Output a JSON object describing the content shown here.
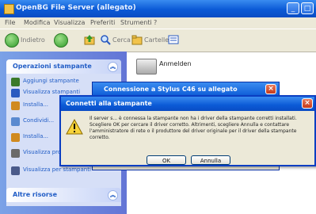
{
  "window": {
    "title": "OpenBG File Server (allegato)",
    "menu": [
      "File",
      "Modifica",
      "Visualizza",
      "Preferiti",
      "Strumenti",
      "?"
    ],
    "toolbar": {
      "back_label": "Indietro",
      "search_label": "Cerca",
      "folders_label": "Cartelle"
    }
  },
  "task_pane": {
    "section_title": "Operazioni stampante",
    "tasks": [
      {
        "label": "Aggiungi stampante",
        "icon": "add-printer-icon",
        "color": "#3a7a2a"
      },
      {
        "label": "Visualizza stampanti",
        "icon": "view-icon",
        "color": "#2a5ac0"
      },
      {
        "label": "Installa...",
        "icon": "install-icon",
        "color": "#d08a20"
      },
      {
        "label": "Condividi...",
        "icon": "share-icon",
        "color": "#5a8ad0"
      },
      {
        "label": "Installa...",
        "icon": "install-icon",
        "color": "#d08a20"
      },
      {
        "label": "Visualizza proprietà",
        "icon": "properties-icon",
        "color": "#6a6a6a"
      },
      {
        "label": "Visualizza per stampanti",
        "icon": "printer-icon",
        "color": "#4a5a8a"
      }
    ],
    "other_title": "Altre risorse"
  },
  "printer_item": {
    "label": "Anmelden"
  },
  "connection_window": {
    "title": "Connessione a Stylus C46 su allegato"
  },
  "dialog": {
    "title": "Connetti alla stampante",
    "message": "Il server s... è connessa la stampante non ha i driver della stampante corretti installati. Scegliere OK per cercare il driver corretto. Altrimenti, scegliere Annulla e contattare l'amministratore di rete o il produttore del driver originale per il driver della stampante corretto.",
    "ok_label": "OK",
    "cancel_label": "Annulla"
  }
}
